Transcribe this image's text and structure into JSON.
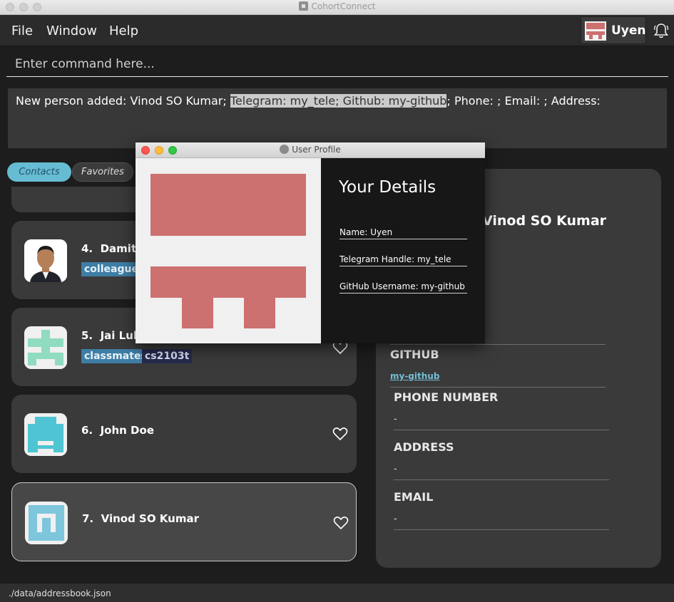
{
  "window": {
    "title": "CohortConnect"
  },
  "menu": {
    "file": "File",
    "window": "Window",
    "help": "Help"
  },
  "user": {
    "name": "Uyen"
  },
  "command": {
    "placeholder": "Enter command here..."
  },
  "result": {
    "prefix": "New person added: Vinod SO Kumar; ",
    "highlight": "Telegram: my_tele; Github: my-github",
    "suffix": "; Phone: ; Email: ; Address:"
  },
  "tabs": {
    "contacts": "Contacts",
    "favorites": "Favorites"
  },
  "contacts": [
    {
      "index": "4.",
      "name": "Damith",
      "tags": [
        "colleagues"
      ]
    },
    {
      "index": "5.",
      "name": "Jai Lulla",
      "tags": [
        "classmates",
        "cs2103t"
      ]
    },
    {
      "index": "6.",
      "name": "John Doe",
      "tags": []
    },
    {
      "index": "7.",
      "name": "Vinod SO Kumar",
      "tags": []
    }
  ],
  "details": {
    "name": "Vinod SO Kumar",
    "github_label": "GITHUB",
    "github_value": "my-github",
    "phone_label": "PHONE NUMBER",
    "phone_value": "-",
    "address_label": "ADDRESS",
    "address_value": "-",
    "email_label": "EMAIL",
    "email_value": "-"
  },
  "status": {
    "path": "./data/addressbook.json"
  },
  "popup": {
    "title": "User Profile",
    "heading": "Your Details",
    "name_field": "Name: Uyen",
    "telegram_field": "Telegram Handle: my_tele",
    "github_field": "GitHub Username: my-github"
  },
  "colors": {
    "accent": "#66bcd3",
    "tag_blue": "#3e7ea6",
    "tag_navy": "#262a4c",
    "avatar_red": "#cd7070",
    "link": "#73bfd8"
  }
}
